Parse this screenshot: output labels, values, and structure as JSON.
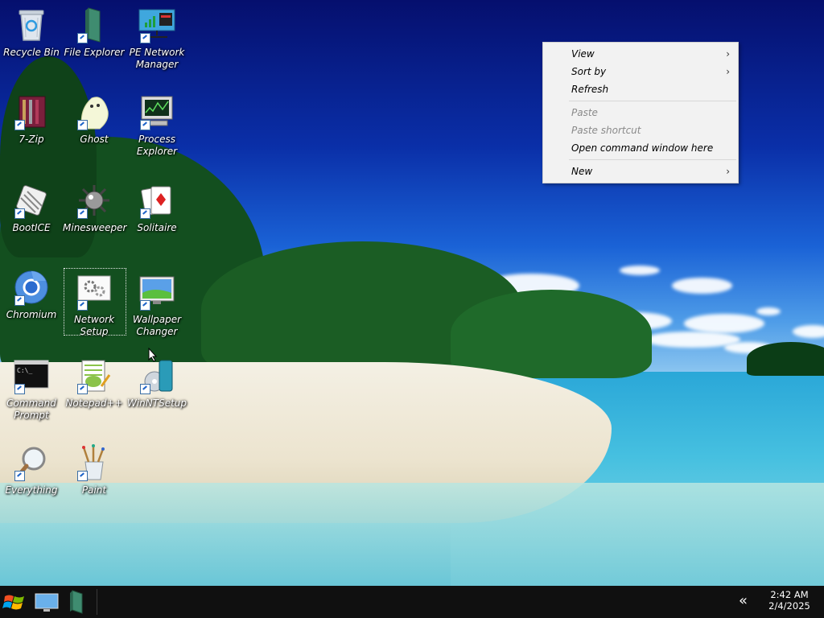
{
  "desktop": {
    "icons": [
      {
        "label": "Recycle Bin",
        "icon": "recycle-bin-icon"
      },
      {
        "label": "File Explorer",
        "icon": "file-explorer-icon"
      },
      {
        "label": "PE Network Manager",
        "icon": "network-manager-icon"
      },
      {
        "label": "7-Zip",
        "icon": "7zip-icon"
      },
      {
        "label": "Ghost",
        "icon": "ghost-icon"
      },
      {
        "label": "Process Explorer",
        "icon": "process-explorer-icon"
      },
      {
        "label": "BootICE",
        "icon": "bootice-icon"
      },
      {
        "label": "Minesweeper",
        "icon": "minesweeper-icon"
      },
      {
        "label": "Solitaire",
        "icon": "solitaire-icon"
      },
      {
        "label": "Chromium",
        "icon": "chromium-icon"
      },
      {
        "label": "Network Setup",
        "icon": "network-setup-icon"
      },
      {
        "label": "Wallpaper Changer",
        "icon": "wallpaper-changer-icon"
      },
      {
        "label": "Command Prompt",
        "icon": "command-prompt-icon"
      },
      {
        "label": "Notepad++",
        "icon": "notepadpp-icon"
      },
      {
        "label": "WinNTSetup",
        "icon": "winntsetup-icon"
      },
      {
        "label": "Everything",
        "icon": "everything-icon"
      },
      {
        "label": "Paint",
        "icon": "paint-icon"
      }
    ]
  },
  "context_menu": {
    "view": "View",
    "sort_by": "Sort by",
    "refresh": "Refresh",
    "paste": "Paste",
    "paste_shortcut": "Paste shortcut",
    "open_command_window": "Open command window here",
    "new": "New"
  },
  "taskbar": {
    "tray_chevron": "«",
    "time": "2:42 AM",
    "date": "2/4/2025"
  },
  "colors": {
    "taskbar_bg": "#101010",
    "menu_bg": "#f2f2f2",
    "menu_disabled_text": "#8a8a8a"
  }
}
